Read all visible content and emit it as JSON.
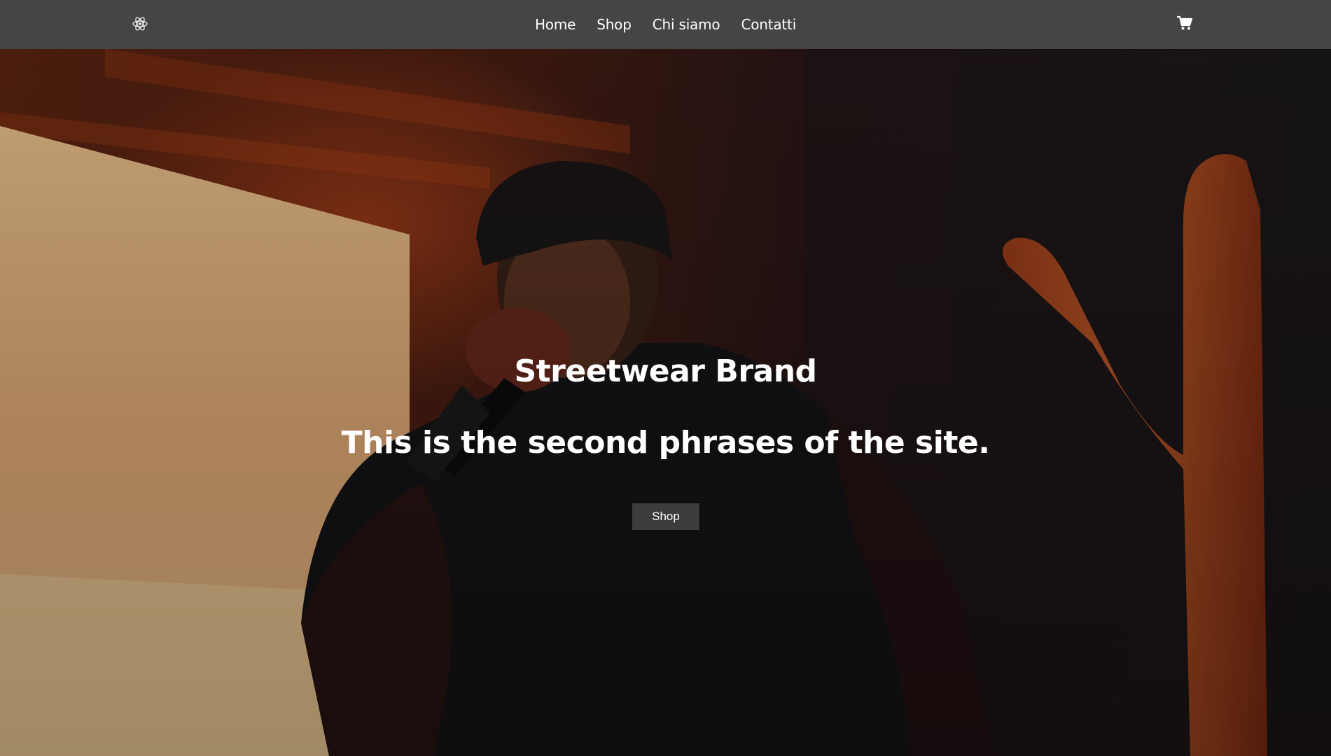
{
  "navbar": {
    "logo_icon": "react-atom-icon",
    "links": [
      "Home",
      "Shop",
      "Chi siamo",
      "Contatti"
    ],
    "cart_icon": "shopping-cart-icon",
    "background": "#454545"
  },
  "hero": {
    "title": "Streetwear Brand",
    "subtitle": "This is the second phrases of the site.",
    "button_label": "Shop",
    "image": "concert-performer-with-microphone"
  }
}
